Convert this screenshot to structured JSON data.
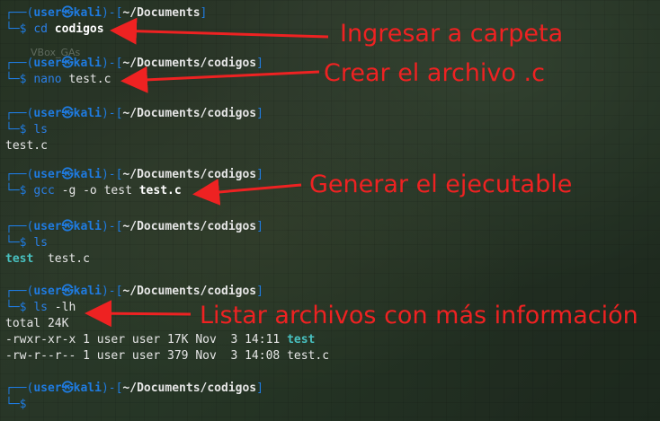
{
  "watermark": "VBox_GAs",
  "prompt": {
    "corner_top": "┌──(",
    "user": "user",
    "at": "㉿",
    "host": "kali",
    "mid": ")-[",
    "close": "]",
    "corner_bottom": "└─",
    "dollar": "$"
  },
  "blocks": [
    {
      "path": "~/Documents",
      "cmd": "cd",
      "args": "codigos",
      "args_bold": true
    },
    {
      "path": "~/Documents/codigos",
      "cmd": "nano",
      "args": "test.c"
    },
    {
      "path": "~/Documents/codigos",
      "cmd": "ls",
      "output": [
        "test.c"
      ]
    },
    {
      "path": "~/Documents/codigos",
      "cmd": "gcc",
      "args": "-g -o test",
      "args_tail": "test.c"
    },
    {
      "path": "~/Documents/codigos",
      "cmd": "ls",
      "output_exe": "test",
      "output_rest": "  test.c"
    },
    {
      "path": "~/Documents/codigos",
      "cmd": "ls",
      "args": "-lh",
      "output": [
        "total 24K"
      ],
      "ls_rows": [
        {
          "perm": "-rwxr-xr-x",
          "links": "1",
          "owner": "user",
          "group": "user",
          "size": "17K",
          "month": "Nov",
          "day": "3",
          "time": "14:11",
          "name": "test",
          "exe": true
        },
        {
          "perm": "-rw-r--r--",
          "links": "1",
          "owner": "user",
          "group": "user",
          "size": "379",
          "month": "Nov",
          "day": "3",
          "time": "14:08",
          "name": "test.c",
          "exe": false
        }
      ]
    },
    {
      "path": "~/Documents/codigos",
      "cmd": ""
    }
  ],
  "annotations": [
    {
      "text": "Ingresar a carpeta"
    },
    {
      "text": "Crear el archivo .c"
    },
    {
      "text": "Generar el ejecutable"
    },
    {
      "text": "Listar archivos con más información"
    }
  ],
  "colors": {
    "prompt": "#1f7be0",
    "annotation": "#ee2222",
    "executable": "#48c0c0",
    "text": "#e6e6e6"
  }
}
